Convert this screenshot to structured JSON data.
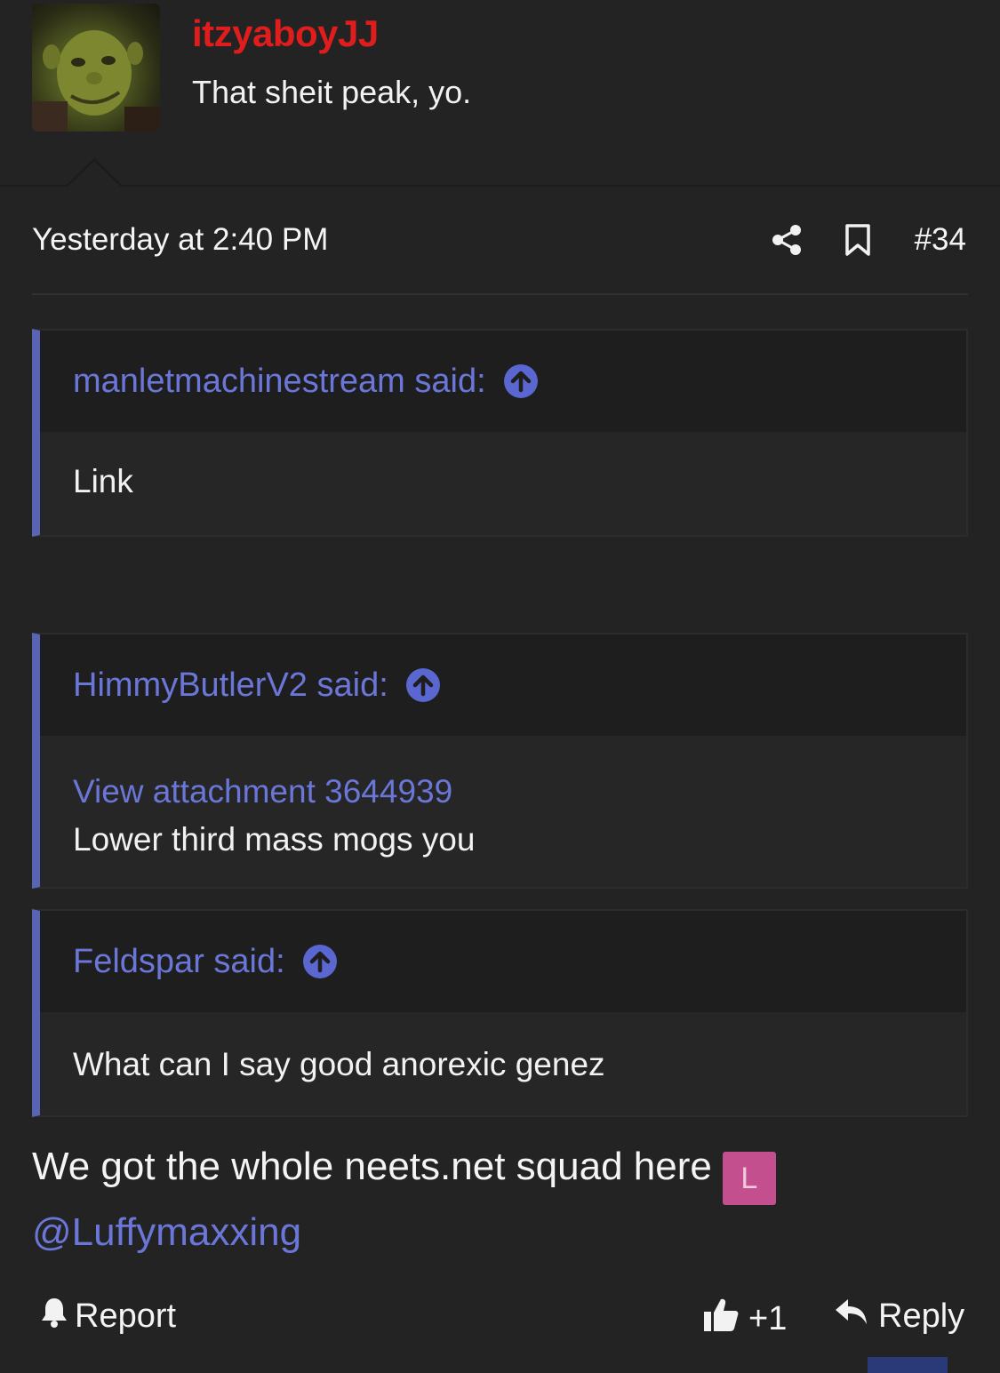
{
  "user": {
    "username": "itzyaboyJJ",
    "title": "That sheit peak, yo."
  },
  "post": {
    "date": "Yesterday at 2:40 PM",
    "number": "#34"
  },
  "quotes": [
    {
      "author": "manletmachinestream said:",
      "body": "Link"
    },
    {
      "author": "HimmyButlerV2 said:",
      "link": "View attachment 3644939",
      "body": "Lower third mass mogs you"
    },
    {
      "author": "Feldspar said:",
      "body": "What can I say good anorexic genez"
    }
  ],
  "message": {
    "text": "We got the whole neets.net squad here",
    "avatar_letter": "L",
    "mention": "@Luffymaxxing"
  },
  "footer": {
    "report_label": "Report",
    "like_label": "+1",
    "reply_label": "Reply"
  },
  "colors": {
    "background": "#232323",
    "username": "#e01d1d",
    "accent": "#6b77d8",
    "quote_bar": "#5a64b4",
    "mention_avatar": "#c44f8f"
  }
}
